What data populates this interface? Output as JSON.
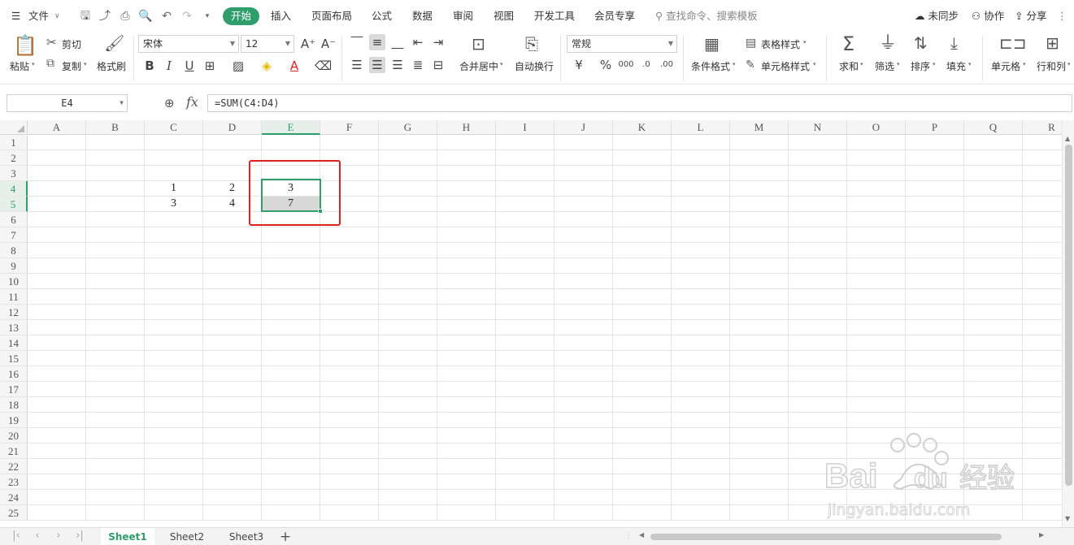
{
  "menubar": {
    "file_label": "文件",
    "tabs": [
      "开始",
      "插入",
      "页面布局",
      "公式",
      "数据",
      "审阅",
      "视图",
      "开发工具",
      "会员专享"
    ],
    "search_placeholder": "查找命令、搜索模板",
    "sync_label": "未同步",
    "collab_label": "协作",
    "share_label": "分享"
  },
  "ribbon": {
    "paste": "粘贴",
    "cut": "剪切",
    "copy": "复制",
    "format_painter": "格式刷",
    "font_name": "宋体",
    "font_size": "12",
    "merge_center": "合并居中",
    "wrap_text": "自动换行",
    "number_format": "常规",
    "conditional_format": "条件格式",
    "table_style": "表格样式",
    "cell_style": "单元格样式",
    "sum": "求和",
    "filter": "筛选",
    "sort": "排序",
    "fill": "填充",
    "cell": "单元格",
    "row_col": "行和列"
  },
  "formula_bar": {
    "name_box": "E4",
    "fx_label": "fx",
    "formula": "=SUM(C4:D4)"
  },
  "grid": {
    "columns": [
      "A",
      "B",
      "C",
      "D",
      "E",
      "F",
      "G",
      "H",
      "I",
      "J",
      "K",
      "L",
      "M",
      "N",
      "O",
      "P",
      "Q",
      "R"
    ],
    "rows": [
      "1",
      "2",
      "3",
      "4",
      "5",
      "6",
      "7",
      "8",
      "9",
      "10",
      "11",
      "12",
      "13",
      "14",
      "15",
      "16",
      "17",
      "18",
      "19",
      "20",
      "21",
      "22",
      "23",
      "24",
      "25"
    ],
    "selected_column": "E",
    "selected_rows": [
      "4",
      "5"
    ],
    "cells": {
      "C4": "1",
      "D4": "2",
      "E4": "3",
      "C5": "3",
      "D5": "4",
      "E5": "7"
    }
  },
  "sheets": {
    "tabs": [
      "Sheet1",
      "Sheet2",
      "Sheet3"
    ],
    "active": "Sheet1"
  },
  "watermark": {
    "brand": "Bai du 经验",
    "url": "jingyan.baidu.com"
  },
  "colors": {
    "accent": "#2f9e6b",
    "annotation": "#e02020"
  }
}
